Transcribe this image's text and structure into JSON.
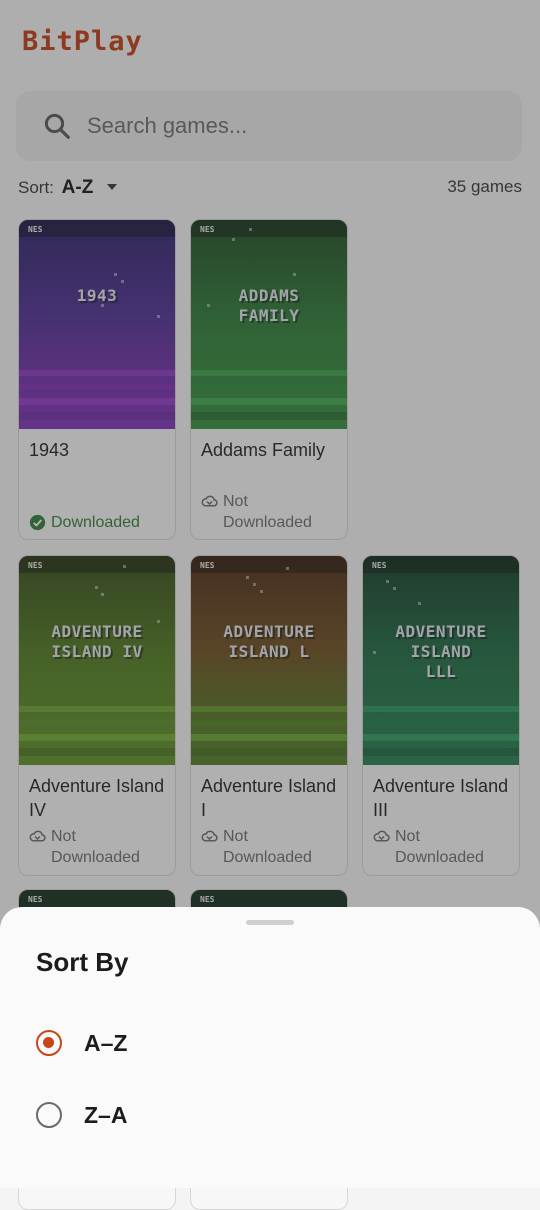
{
  "app": {
    "title": "BitPlay"
  },
  "search": {
    "placeholder": "Search games..."
  },
  "sort": {
    "label": "Sort:",
    "value": "A-Z",
    "count": "35 games"
  },
  "games": [
    {
      "platform": "NES",
      "cover_text": "1943",
      "name": "1943",
      "status": "Downloaded",
      "downloaded": true
    },
    {
      "platform": "NES",
      "cover_text": "ADDAMS\nFAMILY",
      "name": "Addams Family",
      "status_line1": "Not",
      "status_line2": "Downloaded",
      "downloaded": false
    },
    {
      "platform": "NES",
      "cover_text": "ADVENTURE\nISLAND IV",
      "name": "Adventure Island IV",
      "status_line1": "Not",
      "status_line2": "Downloaded",
      "downloaded": false
    },
    {
      "platform": "NES",
      "cover_text": "ADVENTURE\nISLAND L",
      "name": "Adventure Island I",
      "status_line1": "Not",
      "status_line2": "Downloaded",
      "downloaded": false
    },
    {
      "platform": "NES",
      "cover_text": "ADVENTURE\nISLAND\nLLL",
      "name": "Adventure Island III",
      "status_line1": "Not",
      "status_line2": "Downloaded",
      "downloaded": false
    },
    {
      "platform": "NES"
    },
    {
      "platform": "NES"
    }
  ],
  "sheet": {
    "title": "Sort By",
    "options": [
      {
        "label": "A–Z",
        "selected": true
      },
      {
        "label": "Z–A",
        "selected": false
      }
    ]
  },
  "colors": {
    "accent": "#c8451a",
    "downloaded": "#2d7a33"
  }
}
